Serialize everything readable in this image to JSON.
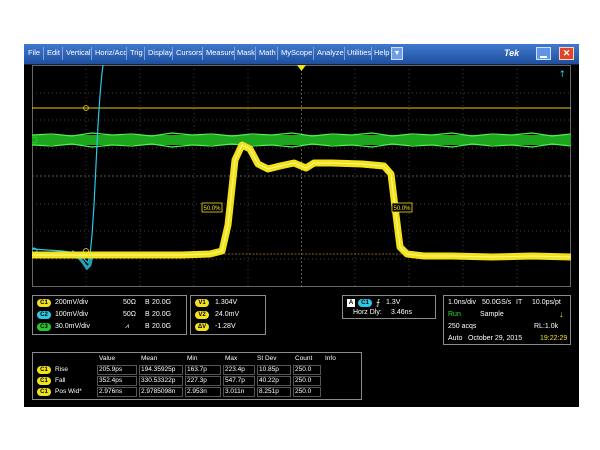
{
  "menu": {
    "items": [
      "File",
      "Edit",
      "Vertical",
      "Horiz/Acq",
      "Trig",
      "Display",
      "Cursors",
      "Measure",
      "Mask",
      "Math",
      "MyScope",
      "Analyze",
      "Utilities",
      "Help"
    ],
    "brand": "Tek",
    "dropdown": "▼",
    "close": "✕"
  },
  "graticule": {
    "ref50_left": "50.0%",
    "ref50_right": "50.0%"
  },
  "channels": {
    "c1": {
      "badge": "C1",
      "scale": "200mV/div",
      "impedance": "50Ω",
      "bw_label": "B",
      "bw_value": "20.0G"
    },
    "c2": {
      "badge": "C2",
      "scale": "100mV/div",
      "impedance": "50Ω",
      "bw_label": "B",
      "bw_value": "20.0G"
    },
    "c3": {
      "badge": "C3",
      "scale": "30.0mV/div",
      "impedance": "⩘",
      "bw_label": "B",
      "bw_value": "20.0G"
    }
  },
  "cursors": {
    "v1_label": "V1",
    "v1_value": "1.304V",
    "v2_label": "V2",
    "v2_value": "24.0mV",
    "dv_label": "ΔV",
    "dv_value": "-1.28V"
  },
  "trigger": {
    "mode_badge": "A",
    "source_badge": "C1",
    "slope": "⨍",
    "level": "1.3V",
    "horz_dly_label": "Horz Dly:",
    "horz_dly_value": "3.46ns"
  },
  "acquisition": {
    "horiz": "1.0ns/div",
    "rate": "50.0GS/s",
    "it": "IT",
    "resolution": "10.0ps/pt",
    "state": "Run",
    "mode": "Sample",
    "acqs": "250 acqs",
    "rl": "RL:1.0k",
    "auto": "Auto",
    "date": "October 29, 2015",
    "time": "19:22:29"
  },
  "measurements": {
    "headers": [
      "Value",
      "Mean",
      "Min",
      "Max",
      "St Dev",
      "Count",
      "Info"
    ],
    "rows": [
      {
        "badge": "C1",
        "name": "Rise",
        "value": "205.9ps",
        "mean": "194.35925p",
        "min": "163.7p",
        "max": "223.4p",
        "stdev": "10.85p",
        "count": "250.0"
      },
      {
        "badge": "C1",
        "name": "Fall",
        "value": "352.4ps",
        "mean": "330.53322p",
        "min": "227.3p",
        "max": "547.7p",
        "stdev": "40.22p",
        "count": "250.0"
      },
      {
        "badge": "C1",
        "name": "Pos Wid*",
        "value": "2.976ns",
        "mean": "2.9785098n",
        "min": "2.953n",
        "max": "3.011n",
        "stdev": "8.251p",
        "count": "250.0"
      }
    ]
  },
  "colors": {
    "ch1": "#f1e21b",
    "ch2": "#29c9e8",
    "ch3": "#28c828",
    "run": "#2fe02f",
    "time": "#f1e21b"
  }
}
